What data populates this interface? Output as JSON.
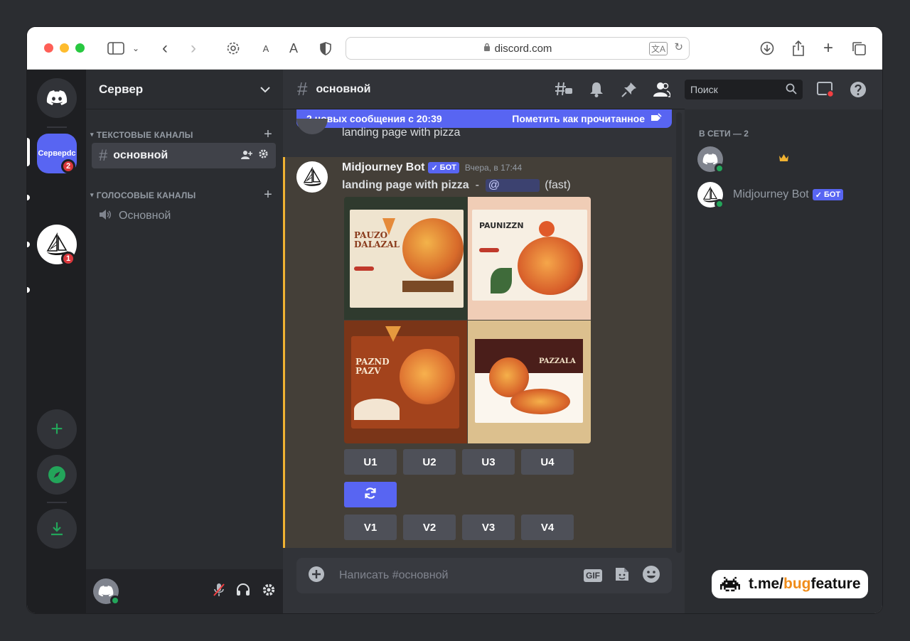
{
  "browser": {
    "url": "discord.com",
    "text_size_small": "A",
    "text_size_large": "A"
  },
  "guilds": {
    "server_label": "Серверdc",
    "server_badge": "2",
    "midjourney_badge": "1"
  },
  "sidebar": {
    "server_name": "Сервер",
    "text_category": "ТЕКСТОВЫЕ КАНАЛЫ",
    "text_channel": "основной",
    "voice_category": "ГОЛОСОВЫЕ КАНАЛЫ",
    "voice_channel": "Основной"
  },
  "header": {
    "channel_name": "основной",
    "search_placeholder": "Поиск"
  },
  "banner": {
    "new_messages": "2 новых сообщения с 20:39",
    "mark_read": "Пометить как прочитанное"
  },
  "prev_message": {
    "text": "landing page with pizza"
  },
  "message": {
    "author": "Midjourney Bot",
    "bot_tag": "БОТ",
    "timestamp": "Вчера, в 17:44",
    "prompt": "landing page with pizza",
    "dash": " - ",
    "mention": "@",
    "speed": "(fast)",
    "upscale_buttons": [
      "U1",
      "U2",
      "U3",
      "U4"
    ],
    "variation_buttons": [
      "V1",
      "V2",
      "V3",
      "V4"
    ],
    "image_titles": [
      "PAUZO DALAZAL",
      "PAUNIZZN",
      "PAZND PAZV",
      "PAZZALA"
    ]
  },
  "composer": {
    "placeholder": "Написать #основной",
    "gif_label": "GIF"
  },
  "members": {
    "heading": "В СЕТИ — 2",
    "bot_name": "Midjourney Bot",
    "bot_tag": "БОТ"
  },
  "watermark": {
    "prefix": "t.me/",
    "highlight": "bug",
    "suffix": "feature"
  },
  "colors": {
    "blurple": "#5865f2",
    "online": "#23a55a",
    "badge_red": "#da373c",
    "highlight_bar": "#f0b232"
  }
}
